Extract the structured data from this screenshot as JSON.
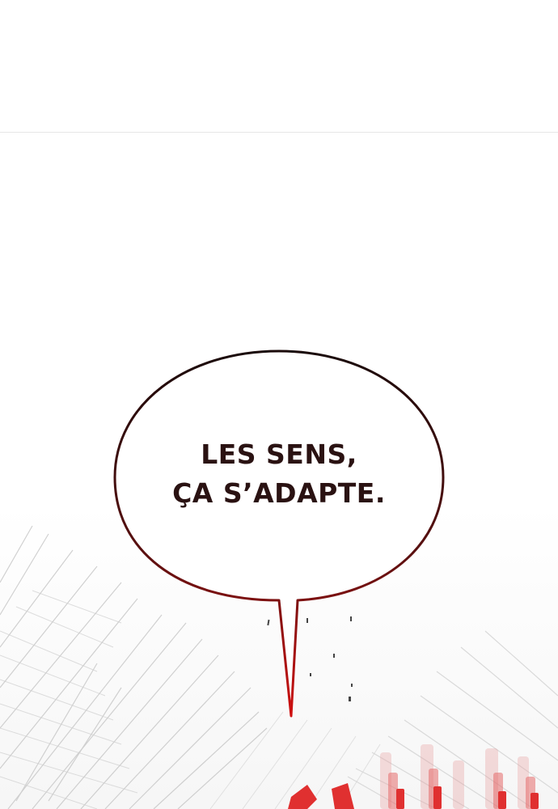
{
  "speech_bubble": {
    "lines": [
      "LES SENS,",
      "ÇA S’ADAPTE."
    ],
    "text_color": "#2a1212",
    "outline_color_top": "#1a0a0a",
    "outline_color_bottom": "#d01010"
  },
  "colors": {
    "background": "#ffffff",
    "panel_divider": "#e6e6e6",
    "speed_lines": "#cfcfcf",
    "sfx_red": "#e03030"
  }
}
